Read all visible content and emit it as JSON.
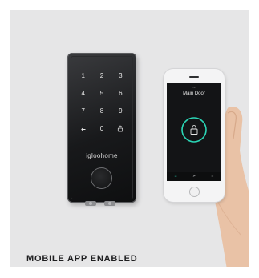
{
  "lock": {
    "keys": [
      "1",
      "2",
      "3",
      "4",
      "5",
      "6",
      "7",
      "8",
      "9",
      "↩",
      "0",
      "🔓"
    ],
    "brand": "igloohome"
  },
  "phone": {
    "status_text": "••••",
    "door_name": "Main Door",
    "accent_color": "#2bd6b6",
    "tabs": [
      {
        "icon": "home-icon",
        "glyph": "⌂"
      },
      {
        "icon": "send-icon",
        "glyph": "➤"
      },
      {
        "icon": "settings-icon",
        "glyph": "≡"
      }
    ]
  },
  "caption": "MOBILE APP ENABLED"
}
